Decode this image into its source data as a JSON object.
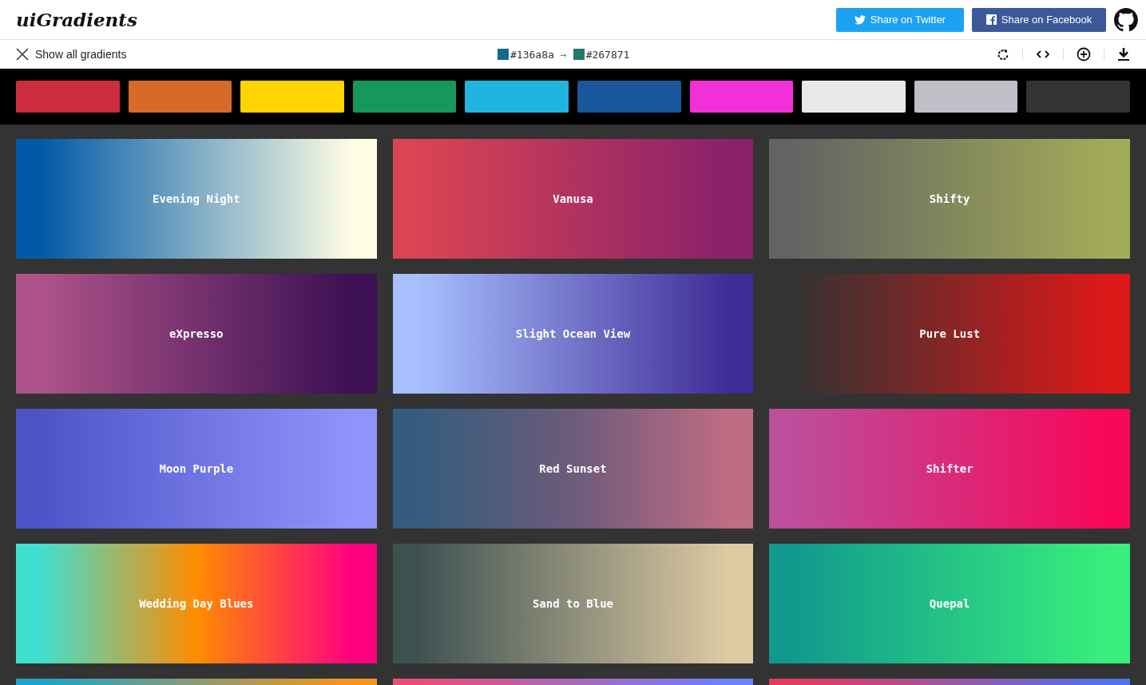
{
  "header": {
    "logo": "uiGradients",
    "share_buttons": [
      {
        "kind": "twitter",
        "label": "Share on Twitter"
      },
      {
        "kind": "facebook",
        "label": "Share on Facebook"
      }
    ]
  },
  "toolbar": {
    "show_all": "Show all gradients",
    "from": {
      "hex": "#136a8a",
      "color": "#136a8a"
    },
    "to": {
      "hex": "#267871",
      "color": "#267871"
    },
    "arrow": "→"
  },
  "palette": [
    {
      "color": "#cb2d3e"
    },
    {
      "color": "#d76a27"
    },
    {
      "color": "#ffd400"
    },
    {
      "color": "#16985a"
    },
    {
      "color": "#1fb5e0"
    },
    {
      "color": "#1a569a"
    },
    {
      "color": "#f230d8"
    },
    {
      "color": "#e8e8e8"
    },
    {
      "color": "#bfbfc8"
    },
    {
      "color": "#333333"
    }
  ],
  "gradients": [
    {
      "name": "Evening Night",
      "stops": [
        {
          "color": "#005aa7"
        },
        {
          "color": "#fffde4"
        }
      ]
    },
    {
      "name": "Vanusa",
      "stops": [
        {
          "color": "#da4453"
        },
        {
          "color": "#89216b"
        }
      ]
    },
    {
      "name": "Shifty",
      "stops": [
        {
          "color": "#636363"
        },
        {
          "color": "#a2ab58"
        }
      ]
    },
    {
      "name": "eXpresso",
      "stops": [
        {
          "color": "#ad5389"
        },
        {
          "color": "#3c1053"
        }
      ]
    },
    {
      "name": "Slight Ocean View",
      "stops": [
        {
          "color": "#a8c0ff"
        },
        {
          "color": "#3f2b96"
        }
      ]
    },
    {
      "name": "Pure Lust",
      "stops": [
        {
          "color": "#333333"
        },
        {
          "color": "#dd1818"
        }
      ]
    },
    {
      "name": "Moon Purple",
      "stops": [
        {
          "color": "#4e54c8"
        },
        {
          "color": "#8f94fb"
        }
      ]
    },
    {
      "name": "Red Sunset",
      "stops": [
        {
          "color": "#355c7d"
        },
        {
          "color": "#6c5b7b"
        },
        {
          "color": "#c06c84"
        }
      ]
    },
    {
      "name": "Shifter",
      "stops": [
        {
          "color": "#bc4e9c"
        },
        {
          "color": "#f80759"
        }
      ]
    },
    {
      "name": "Wedding Day Blues",
      "stops": [
        {
          "color": "#40e0d0"
        },
        {
          "color": "#ff8c00"
        },
        {
          "color": "#ff0080"
        }
      ]
    },
    {
      "name": "Sand to Blue",
      "stops": [
        {
          "color": "#3e5151"
        },
        {
          "color": "#decba4"
        }
      ]
    },
    {
      "name": "Quepal",
      "stops": [
        {
          "color": "#11998e"
        },
        {
          "color": "#38ef7d"
        }
      ]
    },
    {
      "stops": [
        {
          "color": "#1fa2c9"
        },
        {
          "color": "#f7941d"
        }
      ]
    },
    {
      "stops": [
        {
          "color": "#e94e77"
        },
        {
          "color": "#6a82fb"
        }
      ]
    },
    {
      "stops": [
        {
          "color": "#e53a5c"
        },
        {
          "color": "#5073e8"
        }
      ]
    }
  ]
}
